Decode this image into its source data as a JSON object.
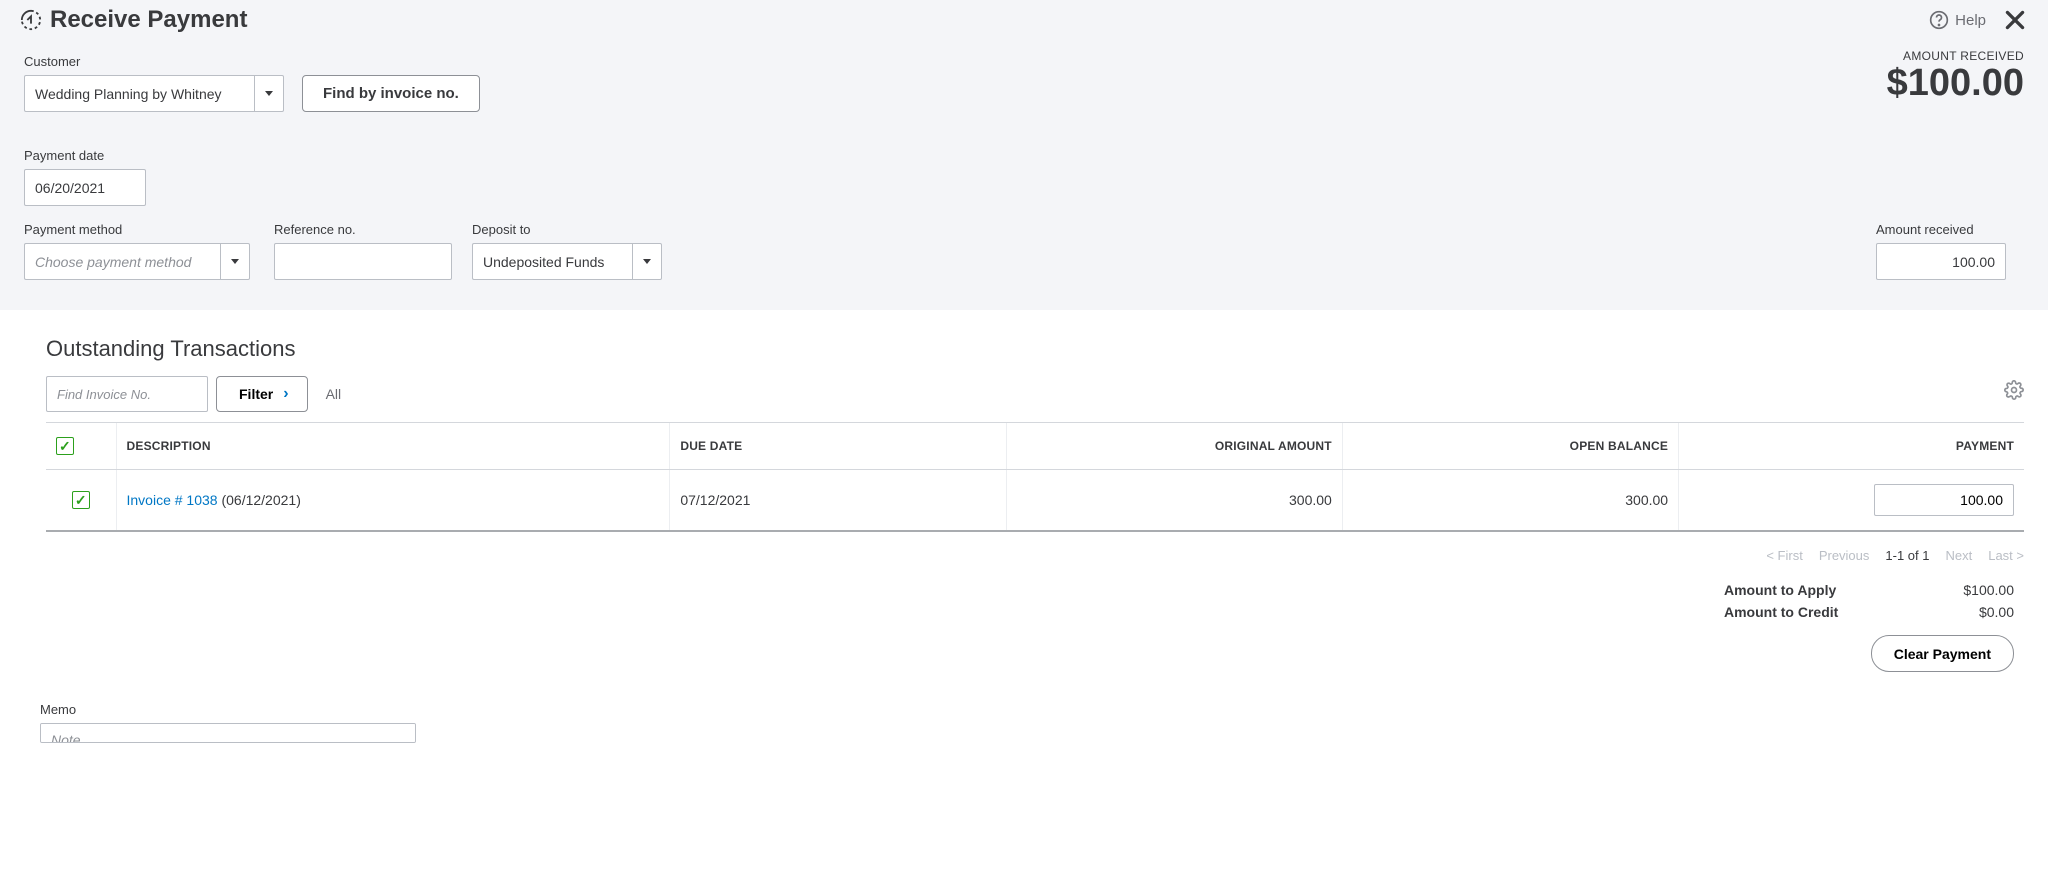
{
  "header": {
    "title": "Receive Payment",
    "help_label": "Help"
  },
  "amount_received_summary": {
    "label": "AMOUNT RECEIVED",
    "value": "$100.00"
  },
  "fields": {
    "customer": {
      "label": "Customer",
      "value": "Wedding Planning by Whitney"
    },
    "find_by_invoice_btn": "Find by invoice no.",
    "payment_date": {
      "label": "Payment date",
      "value": "06/20/2021"
    },
    "payment_method": {
      "label": "Payment method",
      "placeholder": "Choose payment method",
      "value": ""
    },
    "reference_no": {
      "label": "Reference no.",
      "value": ""
    },
    "deposit_to": {
      "label": "Deposit to",
      "value": "Undeposited Funds"
    },
    "amount_received": {
      "label": "Amount received",
      "value": "100.00"
    }
  },
  "transactions": {
    "section_title": "Outstanding Transactions",
    "find_placeholder": "Find Invoice No.",
    "filter_label": "Filter",
    "all_label": "All",
    "columns": {
      "description": "DESCRIPTION",
      "due_date": "DUE DATE",
      "original_amount": "ORIGINAL AMOUNT",
      "open_balance": "OPEN BALANCE",
      "payment": "PAYMENT"
    },
    "rows": [
      {
        "checked": true,
        "invoice_link": "Invoice # 1038",
        "invoice_date": "(06/12/2021)",
        "due_date": "07/12/2021",
        "original_amount": "300.00",
        "open_balance": "300.00",
        "payment": "100.00"
      }
    ]
  },
  "pagination": {
    "first": "< First",
    "previous": "Previous",
    "range": "1-1 of 1",
    "next": "Next",
    "last": "Last >"
  },
  "totals": {
    "amount_to_apply_label": "Amount to Apply",
    "amount_to_apply_value": "$100.00",
    "amount_to_credit_label": "Amount to Credit",
    "amount_to_credit_value": "$0.00",
    "clear_payment_btn": "Clear Payment"
  },
  "memo": {
    "label": "Memo",
    "placeholder": "Note"
  }
}
